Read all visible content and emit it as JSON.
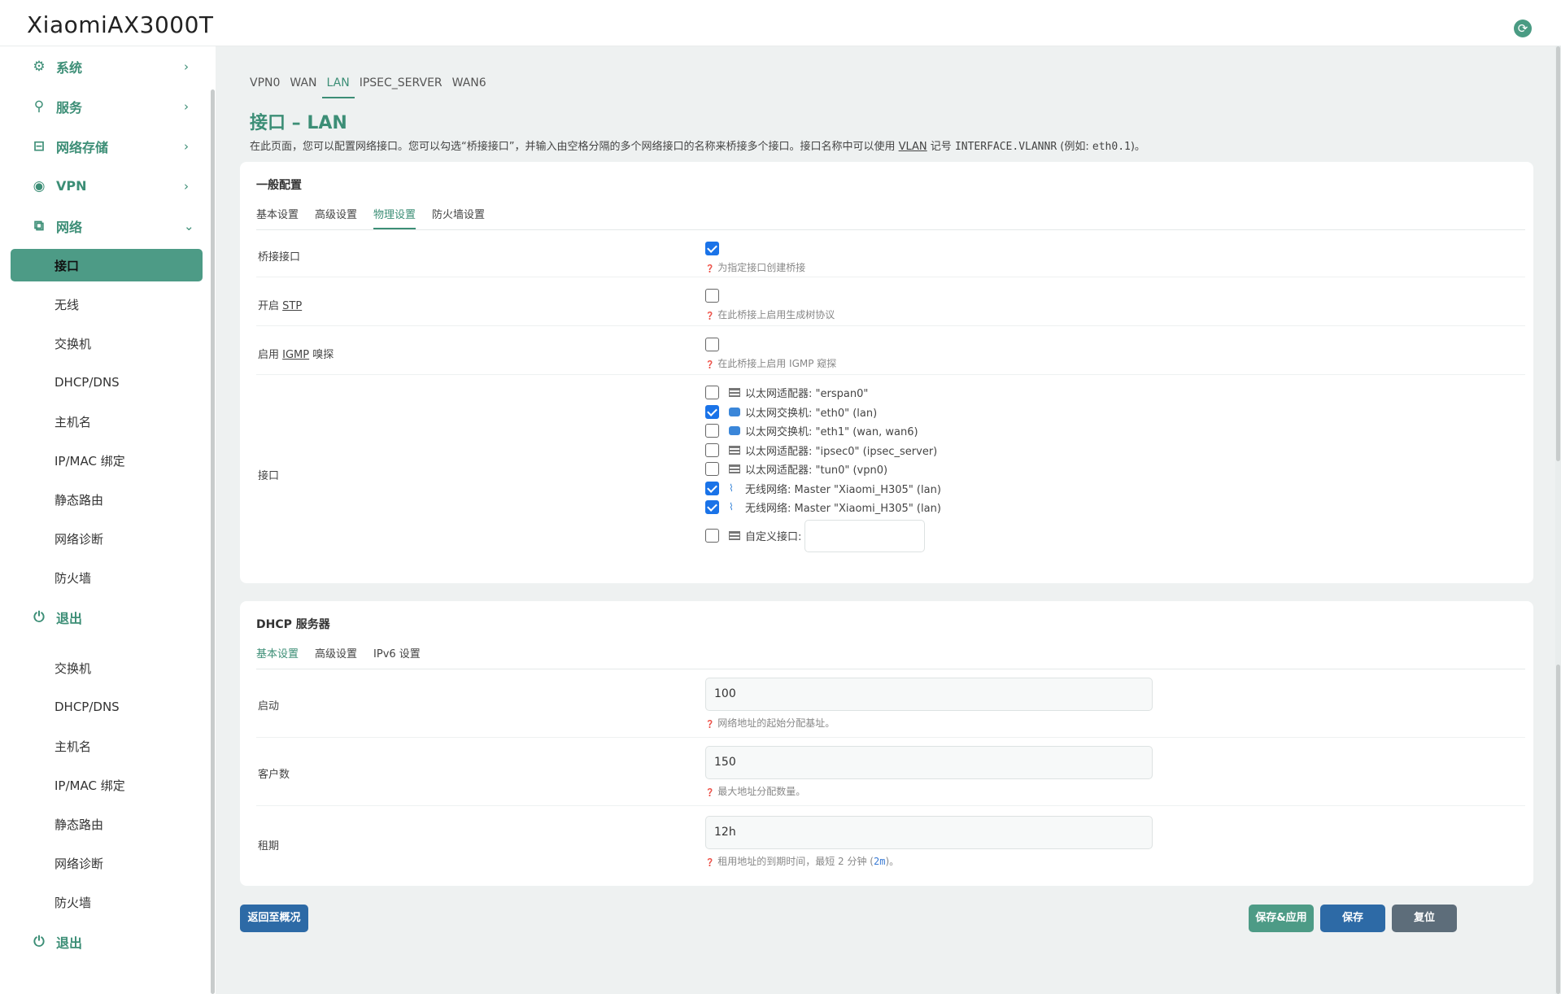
{
  "header": {
    "brand": "XiaomiAX3000T",
    "refresh_icon": "refresh-icon"
  },
  "sidebar": {
    "menus": [
      {
        "label": "系统",
        "icon": "gear-icon"
      },
      {
        "label": "服务",
        "icon": "user-icon"
      },
      {
        "label": "网络存储",
        "icon": "storage-icon"
      },
      {
        "label": "VPN",
        "icon": "globe-icon"
      },
      {
        "label": "网络",
        "icon": "network-icon"
      }
    ],
    "network_items": [
      "接口",
      "无线",
      "交换机",
      "DHCP/DNS",
      "主机名",
      "IP/MAC 绑定",
      "静态路由",
      "网络诊断",
      "防火墙"
    ],
    "logout_label": "退出",
    "extra_items": [
      "交换机",
      "DHCP/DNS",
      "主机名",
      "IP/MAC 绑定",
      "静态路由",
      "网络诊断",
      "防火墙"
    ],
    "logout2_label": "退出"
  },
  "tabs": [
    "VPN0",
    "WAN",
    "LAN",
    "IPSEC_SERVER",
    "WAN6"
  ],
  "page": {
    "title": "接口 – LAN",
    "desc_a": "在此页面，您可以配置网络接口。您可以勾选“桥接接口”，并输入由空格分隔的多个网络接口的名称来桥接多个接口。接口名称中可以使用 ",
    "desc_vlan": "VLAN",
    "desc_b": " 记号 ",
    "desc_code": "INTERFACE.VLANNR",
    "desc_c": " (例如: ",
    "desc_code2": "eth0.1",
    "desc_d": ")。"
  },
  "general": {
    "title": "一般配置",
    "tabs": [
      "基本设置",
      "高级设置",
      "物理设置",
      "防火墙设置"
    ],
    "bridge": {
      "label": "桥接接口",
      "hint": "为指定接口创建桥接",
      "checked": true
    },
    "stp": {
      "label_a": "开启 ",
      "label_u": "STP",
      "hint": "在此桥接上启用生成树协议",
      "checked": false
    },
    "igmp": {
      "label_a": "启用 ",
      "label_u": "IGMP",
      "label_b": " 嗅探",
      "hint": "在此桥接上启用 IGMP 窥探",
      "checked": false
    },
    "interfaces_label": "接口",
    "interfaces": [
      {
        "text": "以太网适配器: \"erspan0\"",
        "icon": "ethernet-adapter-icon",
        "checked": false
      },
      {
        "text": "以太网交换机: \"eth0\" (lan)",
        "icon": "switch-icon",
        "checked": true
      },
      {
        "text": "以太网交换机: \"eth1\" (wan, wan6)",
        "icon": "switch-icon",
        "checked": false
      },
      {
        "text": "以太网适配器: \"ipsec0\" (ipsec_server)",
        "icon": "ethernet-adapter-icon",
        "checked": false
      },
      {
        "text": "以太网适配器: \"tun0\" (vpn0)",
        "icon": "ethernet-adapter-icon",
        "checked": false
      },
      {
        "text": "无线网络: Master \"Xiaomi_H305\" (lan)",
        "icon": "wifi-icon",
        "checked": true
      },
      {
        "text": "无线网络: Master \"Xiaomi_H305\" (lan)",
        "icon": "wifi-icon",
        "checked": true
      }
    ],
    "custom_label": "自定义接口:",
    "custom_value": ""
  },
  "dhcp": {
    "title": "DHCP 服务器",
    "tabs": [
      "基本设置",
      "高级设置",
      "IPv6 设置"
    ],
    "start": {
      "label": "启动",
      "value": "100",
      "hint": "网络地址的起始分配基址。"
    },
    "limit": {
      "label": "客户数",
      "value": "150",
      "hint": "最大地址分配数量。"
    },
    "lease": {
      "label": "租期",
      "value": "12h",
      "hint_a": "租用地址的到期时间，最短 2 分钟 (",
      "hint_code": "2m",
      "hint_b": ")。"
    }
  },
  "buttons": {
    "back": "返回至概况",
    "save_apply": "保存&应用",
    "save": "保存",
    "reset": "复位"
  },
  "colors": {
    "accent": "#3c8e76",
    "active_bg": "#4d9b86",
    "primary": "#2d6aa6",
    "checkbox": "#1a73e8"
  }
}
